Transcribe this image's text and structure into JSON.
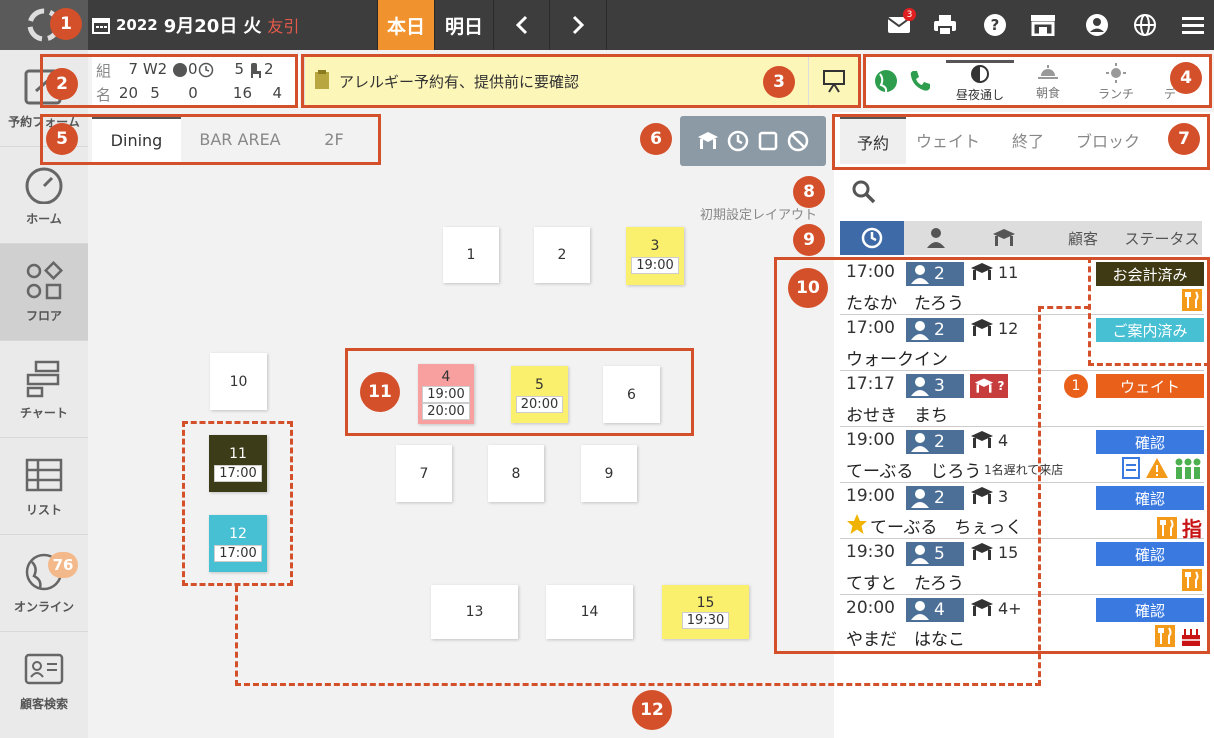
{
  "header": {
    "year": "2022",
    "date": "9月20日",
    "weekday": "火",
    "rokuyo": "友引",
    "today_label": "本日",
    "tomorrow_label": "明日",
    "notification_count": "3",
    "icons": [
      "mail-icon",
      "print-icon",
      "help-icon",
      "store-icon",
      "account-icon",
      "globe-icon",
      "menu-icon"
    ]
  },
  "sidebar": {
    "items": [
      {
        "label": "予約フォーム"
      },
      {
        "label": "ホーム"
      },
      {
        "label": "フロア"
      },
      {
        "label": "チャート"
      },
      {
        "label": "リスト"
      },
      {
        "label": "オンライン"
      },
      {
        "label": "顧客検索"
      }
    ],
    "online_badge": "76"
  },
  "counts": {
    "row1_label": "組",
    "row2_label": "名",
    "groups": "7",
    "wait_label": "W2",
    "online_groups": "0",
    "time_groups": "5",
    "chair_groups": "2",
    "people": "20",
    "wait_people": "5",
    "online_people": "0",
    "time_people": "16",
    "chair_people": "4"
  },
  "alert": {
    "text": "アレルギー予約有、提供前に要確認"
  },
  "meal_modes": [
    {
      "label": "昼夜通し"
    },
    {
      "label": "朝食"
    },
    {
      "label": "ランチ"
    },
    {
      "label": "デ"
    }
  ],
  "area_tabs": [
    {
      "label": "Dining"
    },
    {
      "label": "BAR AREA"
    },
    {
      "label": "2F"
    }
  ],
  "floor": {
    "layout_label": "初期設定レイアウト",
    "tables": [
      {
        "num": "1"
      },
      {
        "num": "2"
      },
      {
        "num": "3",
        "time": "19:00"
      },
      {
        "num": "4",
        "time": "19:00",
        "time2": "20:00"
      },
      {
        "num": "5",
        "time": "20:00"
      },
      {
        "num": "6"
      },
      {
        "num": "7"
      },
      {
        "num": "8"
      },
      {
        "num": "9"
      },
      {
        "num": "10"
      },
      {
        "num": "11",
        "time": "17:00"
      },
      {
        "num": "12",
        "time": "17:00"
      },
      {
        "num": "13"
      },
      {
        "num": "14"
      },
      {
        "num": "15",
        "time": "19:30"
      }
    ]
  },
  "res_tabs": [
    {
      "label": "予約"
    },
    {
      "label": "ウェイト"
    },
    {
      "label": "終了"
    },
    {
      "label": "ブロック"
    }
  ],
  "sort_columns": {
    "customer": "顧客",
    "status": "ステータス"
  },
  "reservations": [
    {
      "time": "17:00",
      "party": "2",
      "table": "11",
      "name": "たなか　たろう",
      "status": "お会計済み"
    },
    {
      "time": "17:00",
      "party": "2",
      "table": "12",
      "name": "ウォークイン",
      "status": "ご案内済み"
    },
    {
      "time": "17:17",
      "party": "3",
      "table": "?",
      "name": "おせき　まち",
      "status": "ウェイト",
      "wait_no": "1"
    },
    {
      "time": "19:00",
      "party": "2",
      "table": "4",
      "name": "てーぶる　じろう",
      "note": "1名遅れて来店",
      "status": "確認"
    },
    {
      "time": "19:00",
      "party": "2",
      "table": "3",
      "name": "てーぶる　ちぇっく",
      "status": "確認",
      "finger": "指"
    },
    {
      "time": "19:30",
      "party": "5",
      "table": "15",
      "name": "てすと　たろう",
      "status": "確認"
    },
    {
      "time": "20:00",
      "party": "4",
      "table": "4+",
      "name": "やまだ　はなこ",
      "status": "確認"
    }
  ],
  "callouts": [
    "1",
    "2",
    "3",
    "4",
    "5",
    "6",
    "7",
    "8",
    "9",
    "10",
    "11",
    "12"
  ],
  "colors": {
    "accent": "#f0922e",
    "callout": "#d4502a",
    "party": "#4c6f98",
    "confirm": "#3a7ae0"
  }
}
